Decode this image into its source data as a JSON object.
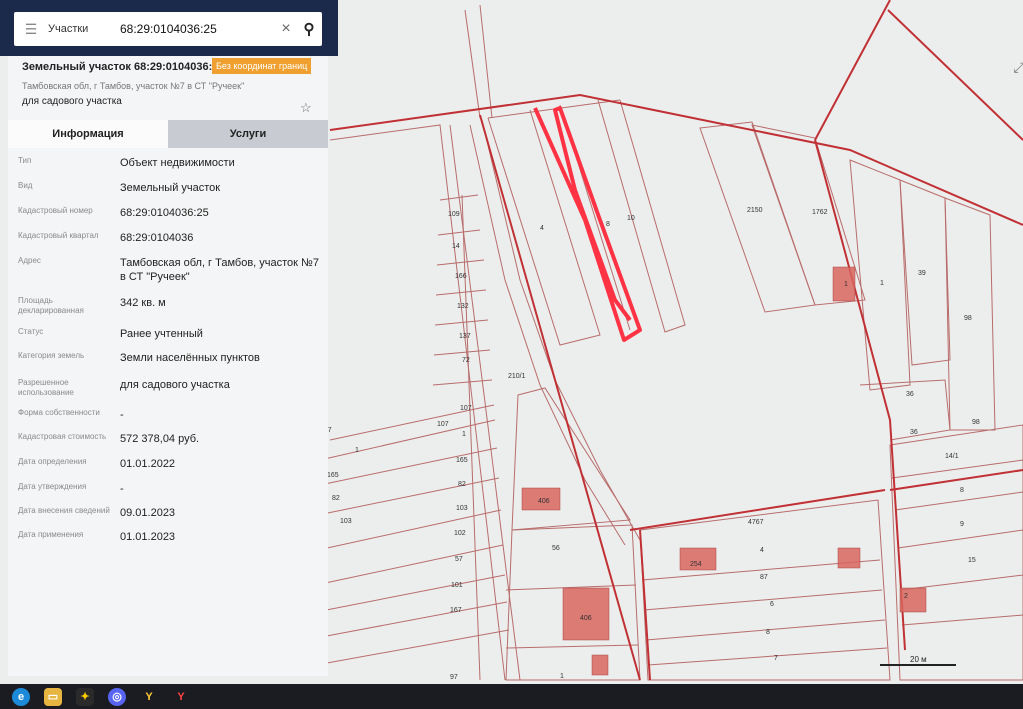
{
  "search": {
    "menu_icon": "hamburger-icon",
    "category": "Участки",
    "query": "68:29:0104036:25",
    "clear_icon": "close-icon",
    "search_icon": "search-icon"
  },
  "panel": {
    "title": "Земельный участок 68:29:0104036:25",
    "badge": "Без координат границ",
    "address_short": "Тамбовская обл, г Тамбов, участок №7 в СТ \"Ручеек\"",
    "usage": "для садового участка",
    "favorite_icon": "star-icon",
    "tabs": [
      "Информация",
      "Услуги"
    ],
    "rows": [
      {
        "label": "Тип",
        "value": "Объект недвижимости"
      },
      {
        "label": "Вид",
        "value": "Земельный участок"
      },
      {
        "label": "Кадастровый номер",
        "value": "68:29:0104036:25"
      },
      {
        "label": "Кадастровый квартал",
        "value": "68:29:0104036"
      },
      {
        "label": "Адрес",
        "value": "Тамбовская обл, г Тамбов, участок №7 в СТ \"Ручеек\""
      },
      {
        "label": "Площадь декларированная",
        "value": "342 кв. м"
      },
      {
        "label": "Статус",
        "value": "Ранее учтенный"
      },
      {
        "label": "Категория земель",
        "value": "Земли населённых пунктов"
      },
      {
        "label": "Разрешенное использование",
        "value": "для садового участка"
      },
      {
        "label": "Форма собственности",
        "value": "-"
      },
      {
        "label": "Кадастровая стоимость",
        "value": "572 378,04 руб."
      },
      {
        "label": "Дата определения",
        "value": "01.01.2022"
      },
      {
        "label": "Дата утверждения",
        "value": "-"
      },
      {
        "label": "Дата внесения сведений",
        "value": "09.01.2023"
      },
      {
        "label": "Дата применения",
        "value": "01.01.2023"
      }
    ]
  },
  "map": {
    "scale": "20 м",
    "parcel_labels": [
      "109",
      "14",
      "166",
      "132",
      "137",
      "72",
      "107",
      "107",
      "1",
      "107",
      "165",
      "165",
      "82",
      "82",
      "103",
      "103",
      "102",
      "57",
      "101",
      "167",
      "97",
      "210/1",
      "4",
      "8",
      "10",
      "2150",
      "1762",
      "1",
      "39",
      "98",
      "36",
      "36",
      "98",
      "14/1",
      "8",
      "9",
      "15",
      "4767",
      "4",
      "87",
      "6",
      "8",
      "7",
      "2",
      "56",
      "406",
      "406",
      "254",
      "1",
      "1",
      "1"
    ],
    "colors": {
      "boundary": "#c03034",
      "parcel": "#b86c6c",
      "highlight": "#ff3344",
      "building": "#d9655e"
    }
  },
  "taskbar": {
    "icons": [
      "edge-icon",
      "folder-icon",
      "yandex-browser-icon",
      "discord-icon",
      "yandex-icon",
      "yandex-red-icon"
    ]
  }
}
